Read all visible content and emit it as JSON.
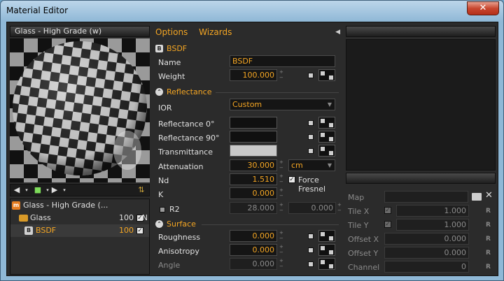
{
  "window": {
    "title": "Material Editor",
    "close": "✕"
  },
  "left": {
    "header": "Glass - High Grade (w)",
    "tree": [
      {
        "label": "Glass - High Grade (...",
        "value": "",
        "checked": false,
        "extra": ""
      },
      {
        "label": "Glass",
        "value": "100",
        "checked": true,
        "extra": "N"
      },
      {
        "label": "BSDF",
        "value": "100",
        "checked": true,
        "extra": ""
      }
    ],
    "badges": {
      "material": "m",
      "bsdf": "B"
    }
  },
  "center": {
    "menu": {
      "options": "Options",
      "wizards": "Wizards"
    },
    "sections": {
      "bsdf": "BSDF",
      "reflectance": "Reflectance",
      "surface": "Surface"
    },
    "fields": {
      "name_label": "Name",
      "name_value": "BSDF",
      "weight_label": "Weight",
      "weight_value": "100.000",
      "ior_label": "IOR",
      "ior_value": "Custom",
      "refl0_label": "Reflectance 0°",
      "refl90_label": "Reflectance 90°",
      "trans_label": "Transmittance",
      "atten_label": "Attenuation",
      "atten_value": "30.000",
      "atten_unit": "cm",
      "nd_label": "Nd",
      "nd_value": "1.510",
      "force_fresnel": "Force Fresnel",
      "k_label": "K",
      "k_value": "0.000",
      "r2_label": "R2",
      "r2_value": "28.000",
      "r2_value2": "0.000",
      "roughness_label": "Roughness",
      "roughness_value": "0.000",
      "aniso_label": "Anisotropy",
      "aniso_value": "0.000",
      "angle_label": "Angle",
      "angle_value": "0.000"
    }
  },
  "right": {
    "map_label": "Map",
    "tilex_label": "Tile X",
    "tilex_value": "1.000",
    "tiley_label": "Tile Y",
    "tiley_value": "1.000",
    "offx_label": "Offset X",
    "offx_value": "0.000",
    "offy_label": "Offset Y",
    "offy_value": "0.000",
    "channel_label": "Channel",
    "channel_value": "0",
    "reset": "R",
    "clear": "✕"
  },
  "colors": {
    "accent": "#f5a623",
    "panel": "#2b2b2b",
    "field": "#151515"
  }
}
